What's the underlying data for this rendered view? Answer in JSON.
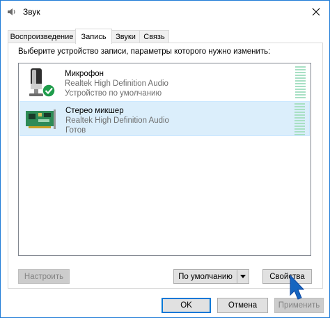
{
  "window": {
    "title": "Звук",
    "close_glyph": "✕"
  },
  "tabs": [
    {
      "label": "Воспроизведение",
      "active": false
    },
    {
      "label": "Запись",
      "active": true
    },
    {
      "label": "Звуки",
      "active": false
    },
    {
      "label": "Связь",
      "active": false
    }
  ],
  "panel": {
    "instruction": "Выберите устройство записи, параметры которого нужно изменить:"
  },
  "devices": [
    {
      "name": "Микрофон",
      "driver": "Realtek High Definition Audio",
      "status": "Устройство по умолчанию",
      "icon": "microphone-icon",
      "badge": "default-check-icon",
      "selected": false
    },
    {
      "name": "Стерео микшер",
      "driver": "Realtek High Definition Audio",
      "status": "Готов",
      "icon": "sound-card-icon",
      "selected": true
    }
  ],
  "buttons": {
    "configure": "Настроить",
    "set_default": "По умолчанию",
    "properties": "Свойства",
    "ok": "OK",
    "cancel": "Отмена",
    "apply": "Применить"
  },
  "colors": {
    "selection": "#dbeefb",
    "accent": "#0078d7",
    "level_meter": "#a8e0c4",
    "check_badge": "#1f9c4b",
    "cursor": "#1565c0"
  }
}
